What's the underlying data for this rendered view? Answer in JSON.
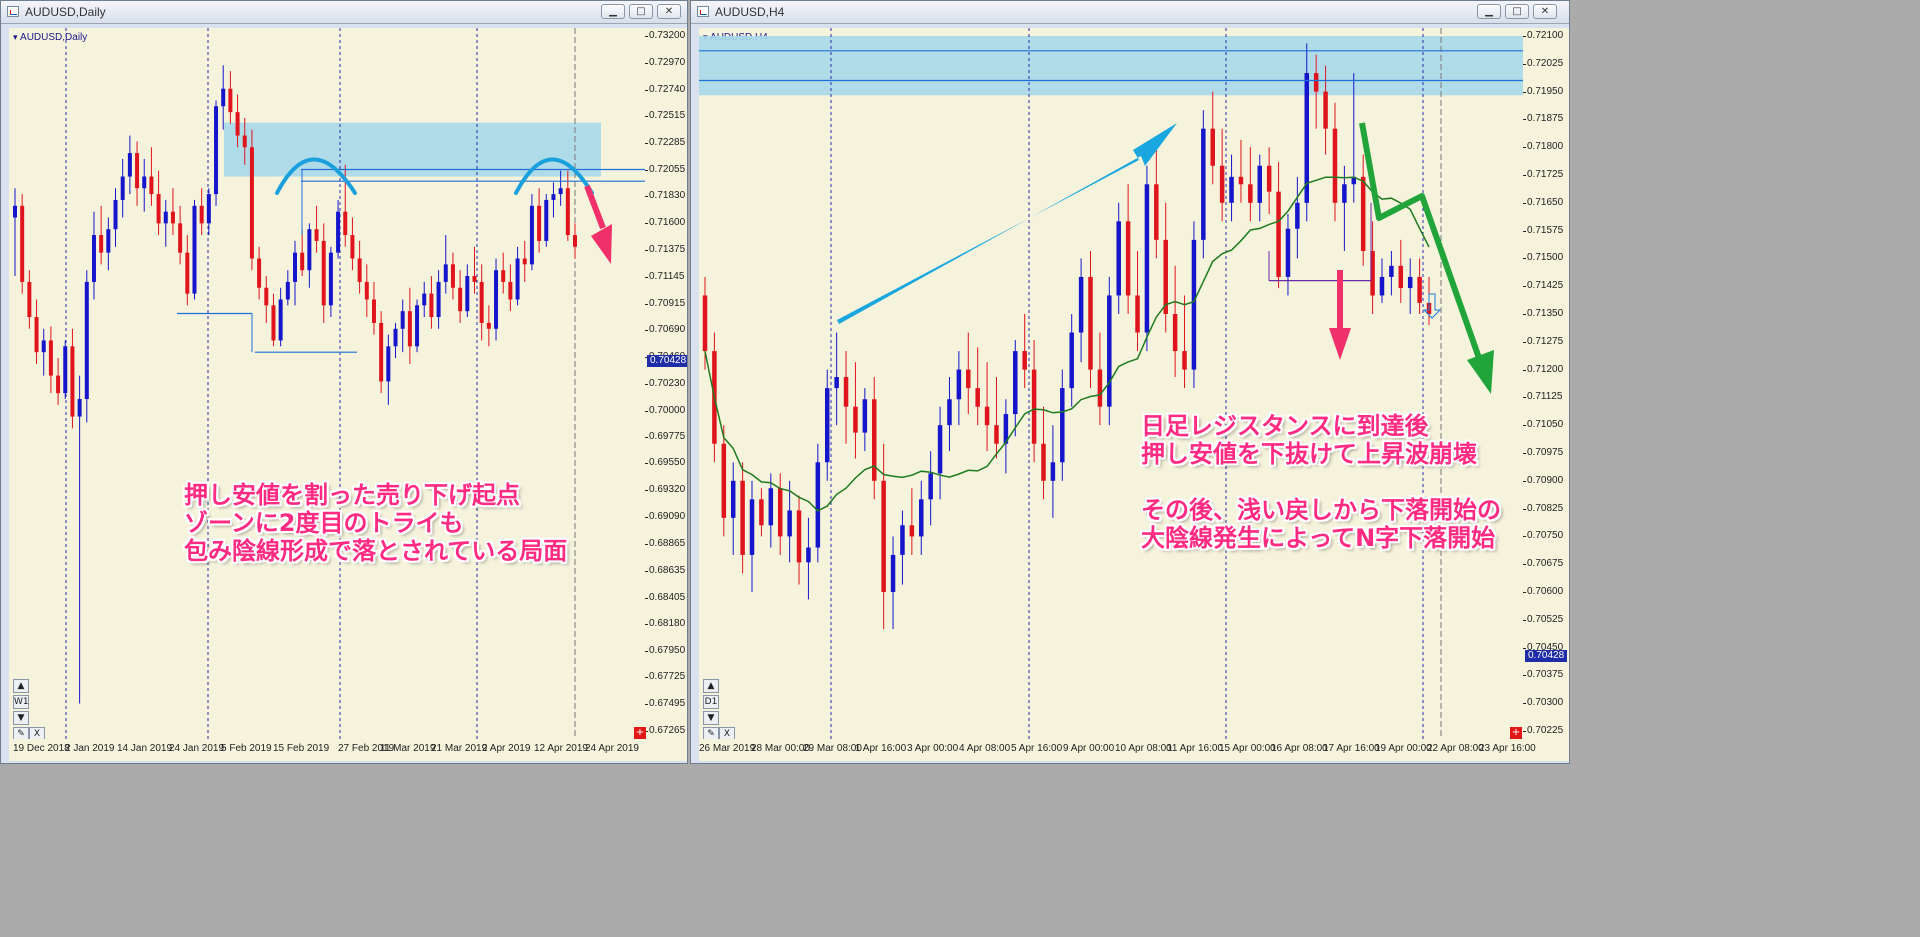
{
  "windows": [
    {
      "id": "left",
      "title": "AUDUSD,Daily",
      "symbol_label": "AUDUSD,Daily",
      "timeframe_box": "W1",
      "current_price": "0.70428",
      "annotation": [
        "押し安値を割った売り下げ起点",
        "ゾーンに2度目のトライも",
        "包み陰線形成で落とされている局面"
      ]
    },
    {
      "id": "right",
      "title": "AUDUSD,H4",
      "symbol_label": "AUDUSD,H4",
      "timeframe_box": "D1",
      "current_price": "0.70428",
      "annotation": [
        "日足レジスタンスに到達後",
        "押し安値を下抜けて上昇波崩壊",
        "",
        "その後、浅い戻しから下落開始の",
        "大陰線発生によってN字下落開始"
      ]
    }
  ],
  "controls": {
    "minimize": "▁",
    "maximize": "□",
    "close": "✕",
    "up": "▲",
    "down": "▼",
    "close_small": "X",
    "new_order": "+"
  },
  "colors": {
    "background": "#f5f3dc",
    "bull": "#1515cc",
    "bear": "#e0141c",
    "zone": "#a8d8ea",
    "ma": "#1f7a1f",
    "annotation": "#ff2a82",
    "arrow_blue": "#1aa7e0",
    "arrow_green": "#21a43a",
    "arrow_pink": "#f0306a"
  },
  "chart_data": [
    {
      "type": "candlestick",
      "title": "AUDUSD,Daily",
      "y_ticks": [
        "0.73200",
        "0.72970",
        "0.72740",
        "0.72515",
        "0.72285",
        "0.72055",
        "0.71830",
        "0.71600",
        "0.71375",
        "0.71145",
        "0.70915",
        "0.70690",
        "0.70460",
        "0.70230",
        "0.70000",
        "0.69775",
        "0.69550",
        "0.69320",
        "0.69090",
        "0.68865",
        "0.68635",
        "0.68405",
        "0.68180",
        "0.67950",
        "0.67725",
        "0.67495",
        "0.67265"
      ],
      "x_ticks": [
        "19 Dec 2018",
        "2 Jan 2019",
        "14 Jan 2019",
        "24 Jan 2019",
        "5 Feb 2019",
        "15 Feb 2019",
        "27 Feb 2019",
        "11 Mar 2019",
        "21 Mar 2019",
        "2 Apr 2019",
        "12 Apr 2019",
        "24 Apr 2019"
      ],
      "ylim": [
        0.67265,
        0.732
      ],
      "candles": [
        [
          0.7165,
          0.719,
          0.7115,
          0.7175
        ],
        [
          0.7175,
          0.7185,
          0.71,
          0.711
        ],
        [
          0.711,
          0.712,
          0.707,
          0.708
        ],
        [
          0.708,
          0.7095,
          0.704,
          0.705
        ],
        [
          0.705,
          0.707,
          0.703,
          0.706
        ],
        [
          0.706,
          0.7072,
          0.7015,
          0.703
        ],
        [
          0.703,
          0.7045,
          0.7005,
          0.7015
        ],
        [
          0.7015,
          0.706,
          0.701,
          0.7055
        ],
        [
          0.7055,
          0.707,
          0.6985,
          0.6995
        ],
        [
          0.6995,
          0.703,
          0.675,
          0.701
        ],
        [
          0.701,
          0.712,
          0.699,
          0.711
        ],
        [
          0.711,
          0.717,
          0.7095,
          0.715
        ],
        [
          0.715,
          0.7175,
          0.7125,
          0.7135
        ],
        [
          0.7135,
          0.7165,
          0.712,
          0.7155
        ],
        [
          0.7155,
          0.719,
          0.714,
          0.718
        ],
        [
          0.718,
          0.7215,
          0.7165,
          0.72
        ],
        [
          0.72,
          0.7235,
          0.7185,
          0.722
        ],
        [
          0.722,
          0.723,
          0.7175,
          0.719
        ],
        [
          0.719,
          0.7215,
          0.717,
          0.72
        ],
        [
          0.72,
          0.7225,
          0.7175,
          0.7185
        ],
        [
          0.7185,
          0.7205,
          0.715,
          0.716
        ],
        [
          0.716,
          0.718,
          0.714,
          0.717
        ],
        [
          0.717,
          0.719,
          0.715,
          0.716
        ],
        [
          0.716,
          0.7175,
          0.7125,
          0.7135
        ],
        [
          0.7135,
          0.715,
          0.709,
          0.71
        ],
        [
          0.71,
          0.718,
          0.7095,
          0.7175
        ],
        [
          0.7175,
          0.719,
          0.715,
          0.716
        ],
        [
          0.716,
          0.719,
          0.715,
          0.7185
        ],
        [
          0.7185,
          0.7265,
          0.7175,
          0.726
        ],
        [
          0.726,
          0.7295,
          0.724,
          0.7275
        ],
        [
          0.7275,
          0.729,
          0.7245,
          0.7255
        ],
        [
          0.7255,
          0.727,
          0.7225,
          0.7235
        ],
        [
          0.7235,
          0.725,
          0.721,
          0.7225
        ],
        [
          0.7225,
          0.724,
          0.712,
          0.713
        ],
        [
          0.713,
          0.714,
          0.7095,
          0.7105
        ],
        [
          0.7105,
          0.7115,
          0.7075,
          0.709
        ],
        [
          0.709,
          0.71,
          0.7055,
          0.706
        ],
        [
          0.706,
          0.7105,
          0.7055,
          0.7095
        ],
        [
          0.7095,
          0.712,
          0.709,
          0.711
        ],
        [
          0.711,
          0.7145,
          0.709,
          0.7135
        ],
        [
          0.7135,
          0.7155,
          0.7115,
          0.712
        ],
        [
          0.712,
          0.716,
          0.7105,
          0.7155
        ],
        [
          0.7155,
          0.7175,
          0.7135,
          0.7145
        ],
        [
          0.7145,
          0.716,
          0.7075,
          0.709
        ],
        [
          0.709,
          0.714,
          0.708,
          0.7135
        ],
        [
          0.7135,
          0.718,
          0.713,
          0.717
        ],
        [
          0.717,
          0.721,
          0.714,
          0.715
        ],
        [
          0.715,
          0.7165,
          0.712,
          0.713
        ],
        [
          0.713,
          0.7145,
          0.71,
          0.711
        ],
        [
          0.711,
          0.7125,
          0.708,
          0.7095
        ],
        [
          0.7095,
          0.711,
          0.7065,
          0.7075
        ],
        [
          0.7075,
          0.7085,
          0.7015,
          0.7025
        ],
        [
          0.7025,
          0.7065,
          0.7005,
          0.7055
        ],
        [
          0.7055,
          0.7075,
          0.7045,
          0.707
        ],
        [
          0.707,
          0.7095,
          0.705,
          0.7085
        ],
        [
          0.7085,
          0.7105,
          0.704,
          0.7055
        ],
        [
          0.7055,
          0.7095,
          0.705,
          0.709
        ],
        [
          0.709,
          0.711,
          0.708,
          0.71
        ],
        [
          0.71,
          0.7115,
          0.707,
          0.708
        ],
        [
          0.708,
          0.712,
          0.707,
          0.711
        ],
        [
          0.711,
          0.715,
          0.71,
          0.7125
        ],
        [
          0.7125,
          0.7135,
          0.7095,
          0.7105
        ],
        [
          0.7105,
          0.712,
          0.7075,
          0.7085
        ],
        [
          0.7085,
          0.7125,
          0.708,
          0.7115
        ],
        [
          0.7115,
          0.714,
          0.71,
          0.711
        ],
        [
          0.711,
          0.7125,
          0.706,
          0.7075
        ],
        [
          0.7075,
          0.709,
          0.7055,
          0.707
        ],
        [
          0.707,
          0.713,
          0.706,
          0.712
        ],
        [
          0.712,
          0.7135,
          0.71,
          0.711
        ],
        [
          0.711,
          0.7125,
          0.7085,
          0.7095
        ],
        [
          0.7095,
          0.714,
          0.709,
          0.713
        ],
        [
          0.713,
          0.7145,
          0.711,
          0.7125
        ],
        [
          0.7125,
          0.7185,
          0.712,
          0.7175
        ],
        [
          0.7175,
          0.719,
          0.7135,
          0.7145
        ],
        [
          0.7145,
          0.7185,
          0.714,
          0.718
        ],
        [
          0.718,
          0.7195,
          0.7165,
          0.7185
        ],
        [
          0.7185,
          0.7205,
          0.7175,
          0.719
        ],
        [
          0.719,
          0.7205,
          0.7145,
          0.715
        ],
        [
          0.715,
          0.716,
          0.713,
          0.714
        ]
      ],
      "zone": [
        0.72,
        0.7246
      ],
      "levels": [
        0.7206,
        0.7196,
        0.7083,
        0.705
      ]
    },
    {
      "type": "candlestick",
      "title": "AUDUSD,H4",
      "y_ticks": [
        "0.72100",
        "0.72025",
        "0.71950",
        "0.71875",
        "0.71800",
        "0.71725",
        "0.71650",
        "0.71575",
        "0.71500",
        "0.71425",
        "0.71350",
        "0.71275",
        "0.71200",
        "0.71125",
        "0.71050",
        "0.70975",
        "0.70900",
        "0.70825",
        "0.70750",
        "0.70675",
        "0.70600",
        "0.70525",
        "0.70450",
        "0.70375",
        "0.70300",
        "0.70225"
      ],
      "x_ticks": [
        "26 Mar 2019",
        "28 Mar 00:00",
        "29 Mar 08:00",
        "1 Apr 16:00",
        "3 Apr 00:00",
        "4 Apr 08:00",
        "5 Apr 16:00",
        "9 Apr 00:00",
        "10 Apr 08:00",
        "11 Apr 16:00",
        "15 Apr 00:00",
        "16 Apr 08:00",
        "17 Apr 16:00",
        "19 Apr 00:00",
        "22 Apr 08:00",
        "23 Apr 16:00"
      ],
      "ylim": [
        0.70225,
        0.721
      ],
      "candles": [
        [
          0.714,
          0.7145,
          0.712,
          0.7125
        ],
        [
          0.7125,
          0.713,
          0.7095,
          0.71
        ],
        [
          0.71,
          0.7105,
          0.7075,
          0.708
        ],
        [
          0.708,
          0.7095,
          0.707,
          0.709
        ],
        [
          0.709,
          0.7095,
          0.7065,
          0.707
        ],
        [
          0.707,
          0.709,
          0.706,
          0.7085
        ],
        [
          0.7085,
          0.7088,
          0.7075,
          0.7078
        ],
        [
          0.7078,
          0.7092,
          0.7072,
          0.7088
        ],
        [
          0.7088,
          0.7092,
          0.707,
          0.7075
        ],
        [
          0.7075,
          0.709,
          0.7068,
          0.7082
        ],
        [
          0.7082,
          0.7086,
          0.7062,
          0.7068
        ],
        [
          0.7068,
          0.708,
          0.7058,
          0.7072
        ],
        [
          0.7072,
          0.71,
          0.7068,
          0.7095
        ],
        [
          0.7095,
          0.712,
          0.709,
          0.7115
        ],
        [
          0.7115,
          0.713,
          0.7105,
          0.7118
        ],
        [
          0.7118,
          0.7125,
          0.71,
          0.711
        ],
        [
          0.711,
          0.7122,
          0.7096,
          0.7103
        ],
        [
          0.7103,
          0.7115,
          0.7098,
          0.7112
        ],
        [
          0.7112,
          0.7118,
          0.7085,
          0.709
        ],
        [
          0.709,
          0.71,
          0.705,
          0.706
        ],
        [
          0.706,
          0.7075,
          0.705,
          0.707
        ],
        [
          0.707,
          0.7082,
          0.7062,
          0.7078
        ],
        [
          0.7078,
          0.7088,
          0.707,
          0.7075
        ],
        [
          0.7075,
          0.709,
          0.707,
          0.7085
        ],
        [
          0.7085,
          0.7098,
          0.7078,
          0.7092
        ],
        [
          0.7092,
          0.711,
          0.7085,
          0.7105
        ],
        [
          0.7105,
          0.7118,
          0.7098,
          0.7112
        ],
        [
          0.7112,
          0.7125,
          0.7105,
          0.712
        ],
        [
          0.712,
          0.713,
          0.7108,
          0.7115
        ],
        [
          0.7115,
          0.7126,
          0.7105,
          0.711
        ],
        [
          0.711,
          0.7122,
          0.7098,
          0.7105
        ],
        [
          0.7105,
          0.7118,
          0.7096,
          0.71
        ],
        [
          0.71,
          0.7112,
          0.7092,
          0.7108
        ],
        [
          0.7108,
          0.7128,
          0.7102,
          0.7125
        ],
        [
          0.7125,
          0.7135,
          0.7115,
          0.712
        ],
        [
          0.712,
          0.7128,
          0.7095,
          0.71
        ],
        [
          0.71,
          0.711,
          0.7085,
          0.709
        ],
        [
          0.709,
          0.7105,
          0.708,
          0.7095
        ],
        [
          0.7095,
          0.712,
          0.709,
          0.7115
        ],
        [
          0.7115,
          0.7135,
          0.711,
          0.713
        ],
        [
          0.713,
          0.715,
          0.7122,
          0.7145
        ],
        [
          0.7145,
          0.7152,
          0.7115,
          0.712
        ],
        [
          0.712,
          0.713,
          0.7105,
          0.711
        ],
        [
          0.711,
          0.7145,
          0.7105,
          0.714
        ],
        [
          0.714,
          0.7165,
          0.7135,
          0.716
        ],
        [
          0.716,
          0.717,
          0.7135,
          0.714
        ],
        [
          0.714,
          0.7152,
          0.7125,
          0.713
        ],
        [
          0.713,
          0.7175,
          0.7125,
          0.717
        ],
        [
          0.717,
          0.718,
          0.715,
          0.7155
        ],
        [
          0.7155,
          0.7165,
          0.713,
          0.7135
        ],
        [
          0.7135,
          0.7148,
          0.7118,
          0.7125
        ],
        [
          0.7125,
          0.714,
          0.7115,
          0.712
        ],
        [
          0.712,
          0.716,
          0.7115,
          0.7155
        ],
        [
          0.7155,
          0.719,
          0.715,
          0.7185
        ],
        [
          0.7185,
          0.7195,
          0.717,
          0.7175
        ],
        [
          0.7175,
          0.7185,
          0.716,
          0.7165
        ],
        [
          0.7165,
          0.7178,
          0.716,
          0.7172
        ],
        [
          0.7172,
          0.7182,
          0.7165,
          0.717
        ],
        [
          0.717,
          0.718,
          0.716,
          0.7165
        ],
        [
          0.7165,
          0.7178,
          0.716,
          0.7175
        ],
        [
          0.7175,
          0.718,
          0.7162,
          0.7168
        ],
        [
          0.7168,
          0.7176,
          0.7142,
          0.7145
        ],
        [
          0.7145,
          0.7162,
          0.714,
          0.7158
        ],
        [
          0.7158,
          0.7172,
          0.715,
          0.7165
        ],
        [
          0.7165,
          0.7208,
          0.716,
          0.72
        ],
        [
          0.72,
          0.7205,
          0.7185,
          0.7195
        ],
        [
          0.7195,
          0.7202,
          0.7178,
          0.7185
        ],
        [
          0.7185,
          0.7192,
          0.716,
          0.7165
        ],
        [
          0.7165,
          0.7175,
          0.7152,
          0.717
        ],
        [
          0.717,
          0.72,
          0.7165,
          0.7172
        ],
        [
          0.7172,
          0.7178,
          0.7148,
          0.7152
        ],
        [
          0.7152,
          0.716,
          0.7135,
          0.714
        ],
        [
          0.714,
          0.715,
          0.7138,
          0.7145
        ],
        [
          0.7145,
          0.7152,
          0.714,
          0.7148
        ],
        [
          0.7148,
          0.7155,
          0.7138,
          0.7142
        ],
        [
          0.7142,
          0.715,
          0.7135,
          0.7145
        ],
        [
          0.7145,
          0.715,
          0.7135,
          0.7138
        ],
        [
          0.7138,
          0.7145,
          0.7132,
          0.7135
        ]
      ],
      "zone": [
        0.7194,
        0.721
      ],
      "levels": [
        0.7206,
        0.7198,
        0.7144
      ],
      "ma_name": ""
    }
  ]
}
